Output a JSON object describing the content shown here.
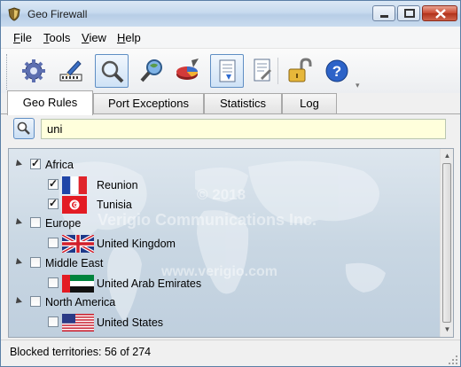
{
  "window": {
    "title": "Geo Firewall"
  },
  "menu": [
    {
      "key": "F",
      "rest": "ile"
    },
    {
      "key": "T",
      "rest": "ools"
    },
    {
      "key": "V",
      "rest": "iew"
    },
    {
      "key": "H",
      "rest": "elp"
    }
  ],
  "toolbar": {
    "buttons": [
      "settings-icon",
      "edit-rules-icon",
      "search-icon",
      "lookup-icon",
      "chart-icon",
      "report-icon",
      "log-icon",
      "lock-icon",
      "help-icon"
    ],
    "active": [
      "search-icon",
      "report-icon"
    ]
  },
  "tabs": [
    {
      "label": "Geo Rules",
      "active": true
    },
    {
      "label": "Port Exceptions",
      "active": false
    },
    {
      "label": "Statistics",
      "active": false
    },
    {
      "label": "Log",
      "active": false
    }
  ],
  "search": {
    "value": "uni",
    "placeholder": ""
  },
  "watermark": {
    "copyright": "© 2018",
    "company": "Verigio Communications Inc.",
    "url": "www.verigio.com"
  },
  "tree": {
    "regions": [
      {
        "name": "Africa",
        "checked": true,
        "countries": [
          {
            "name": "Reunion",
            "checked": true,
            "flag": "france"
          },
          {
            "name": "Tunisia",
            "checked": true,
            "flag": "tunisia"
          }
        ]
      },
      {
        "name": "Europe",
        "checked": false,
        "countries": [
          {
            "name": "United Kingdom",
            "checked": false,
            "flag": "uk"
          }
        ]
      },
      {
        "name": "Middle East",
        "checked": false,
        "countries": [
          {
            "name": "United Arab Emirates",
            "checked": false,
            "flag": "uae"
          }
        ]
      },
      {
        "name": "North America",
        "checked": false,
        "countries": [
          {
            "name": "United States",
            "checked": false,
            "flag": "us"
          }
        ]
      }
    ]
  },
  "status": {
    "text": "Blocked territories: 56 of 274"
  },
  "colors": {
    "accent": "#5f8ec4",
    "search_bg": "#ffffdc",
    "close": "#c9462e"
  }
}
